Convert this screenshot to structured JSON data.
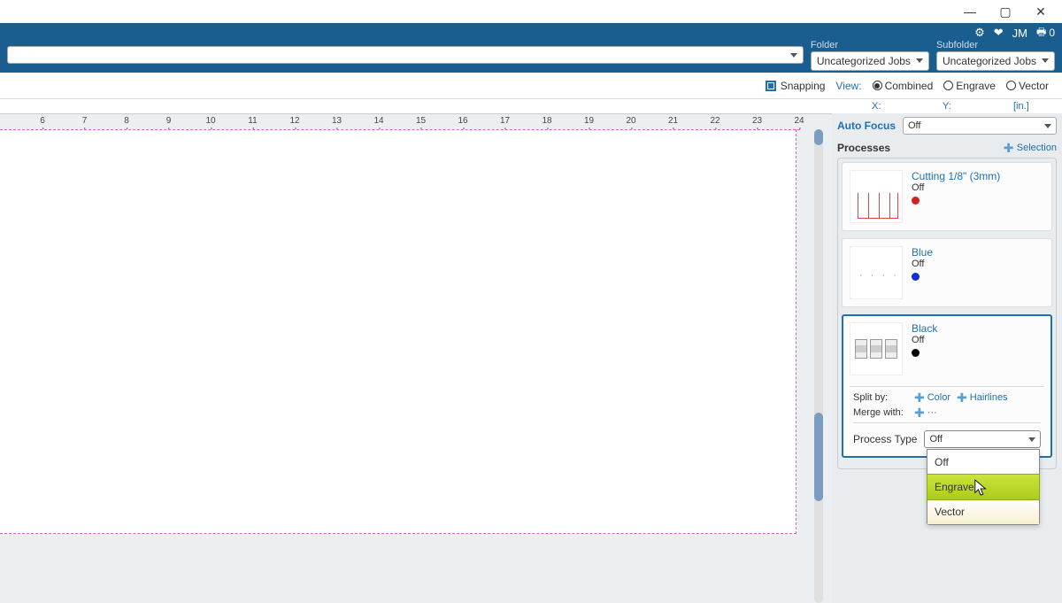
{
  "titlebar": {
    "min": "—",
    "max": "▢",
    "close": "✕"
  },
  "topicons": {
    "gear": "⚙",
    "heart": "❤",
    "initials": "JM",
    "printer": "🖶",
    "count": "0"
  },
  "bar2": {
    "folder_label": "Folder",
    "subfolder_label": "Subfolder",
    "folder_value": "Uncategorized Jobs",
    "subfolder_value": "Uncategorized Jobs"
  },
  "viewbar": {
    "snapping": "Snapping",
    "view": "View:",
    "combined": "Combined",
    "engrave": "Engrave",
    "vector": "Vector"
  },
  "coord": {
    "x": "X:",
    "y": "Y:",
    "unit": "[in.]"
  },
  "ruler": [
    "6",
    "7",
    "8",
    "9",
    "10",
    "11",
    "12",
    "13",
    "14",
    "15",
    "16",
    "17",
    "18",
    "19",
    "20",
    "21",
    "22",
    "23",
    "24"
  ],
  "panel": {
    "autofocus_label": "Auto Focus",
    "autofocus_value": "Off",
    "processes_label": "Processes",
    "selection_label": "Selection",
    "split_label": "Split by:",
    "color": "Color",
    "hairlines": "Hairlines",
    "merge_label": "Merge with:",
    "merge_dots": "···",
    "process_type_label": "Process Type",
    "process_type_value": "Off",
    "options": {
      "off": "Off",
      "engrave": "Engrave",
      "vector": "Vector"
    }
  },
  "processes": [
    {
      "name": "Cutting 1/8\" (3mm)",
      "status": "Off",
      "color": "#d02020"
    },
    {
      "name": "Blue",
      "status": "Off",
      "color": "#1030d0"
    },
    {
      "name": "Black",
      "status": "Off",
      "color": "#000000"
    }
  ]
}
